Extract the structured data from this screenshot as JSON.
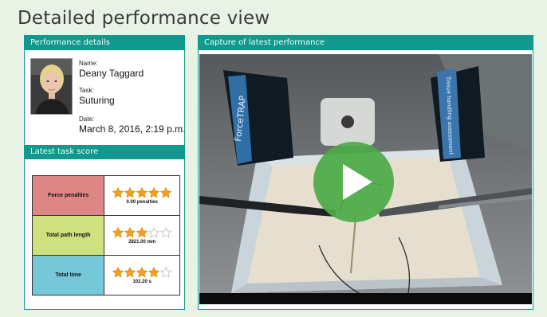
{
  "page": {
    "title": "Detailed performance view"
  },
  "performance_panel": {
    "header": "Performance details",
    "name_label": "Name:",
    "name_value": "Deany Taggard",
    "task_label": "Task:",
    "task_value": "Suturing",
    "date_label": "Date:",
    "date_value": "March 8, 2016, 2:19 p.m."
  },
  "score_panel": {
    "header": "Latest task score",
    "rows": [
      {
        "metric": "Force penalties",
        "stars": 5,
        "value": "0.00 penalties",
        "color": "#dd8686"
      },
      {
        "metric": "Total path length",
        "stars": 3,
        "value": "2821.00 mm",
        "color": "#cfe07e"
      },
      {
        "metric": "Total time",
        "stars": 4,
        "value": "102.20 s",
        "color": "#76c8d9"
      }
    ]
  },
  "video_panel": {
    "header": "Capture of latest performance",
    "device_left_label": "ForceTRAP",
    "device_right_label": "Tissue handling assessment"
  },
  "colors": {
    "accent": "#11998e",
    "background": "#e8f3e6",
    "play": "#4baa46",
    "star_fill": "#f4a11d"
  }
}
